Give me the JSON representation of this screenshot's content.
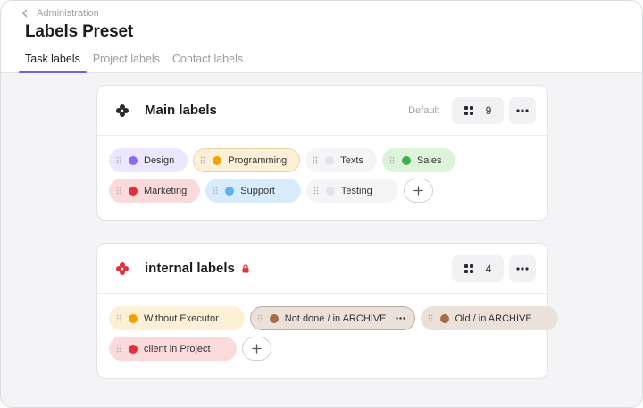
{
  "breadcrumb": {
    "label": "Administration"
  },
  "page": {
    "title": "Labels Preset"
  },
  "tabs": [
    {
      "label": "Task labels",
      "active": true
    },
    {
      "label": "Project labels",
      "active": false
    },
    {
      "label": "Contact labels",
      "active": false
    }
  ],
  "main_card": {
    "title": "Main labels",
    "default_text": "Default",
    "count": "9",
    "rows": [
      [
        {
          "label": "Design",
          "dot": "#8b6cf0",
          "bg": "#ece6ff"
        },
        {
          "label": "Programming",
          "dot": "#f5a100",
          "bg": "#fdf0d6"
        },
        {
          "label": "Texts",
          "dot": "#e3e4ea",
          "bg": "#f5f5f7"
        },
        {
          "label": "Sales",
          "dot": "#3ab44a",
          "bg": "#ddf3da"
        }
      ],
      [
        {
          "label": "Marketing",
          "dot": "#e0303d",
          "bg": "#fbdadc"
        },
        {
          "label": "Support",
          "dot": "#5cb2f5",
          "bg": "#d8ecfd"
        },
        {
          "label": "Testing",
          "dot": "#e3e4ea",
          "bg": "#f5f5f7"
        }
      ]
    ]
  },
  "internal_card": {
    "title": "internal labels",
    "count": "4",
    "rows": [
      [
        {
          "label": "Without Executor",
          "dot": "#f5a100",
          "bg": "#fdf0d6"
        },
        {
          "label": "Not done / in ARCHIVE",
          "dot": "#a46c47",
          "bg": "#ece1d8"
        },
        {
          "label": "Old / in ARCHIVE",
          "dot": "#a46c47",
          "bg": "#ece1d8"
        }
      ],
      [
        {
          "label": "client in Project",
          "dot": "#e0303d",
          "bg": "#fbdadc"
        }
      ]
    ]
  },
  "colors": {
    "accent": "#7a5cf0",
    "lock": "#e0303d",
    "internal_icon": "#e0303d"
  },
  "icons": [
    "chevron-left-icon",
    "clover-icon",
    "lock-icon",
    "grid-icon",
    "more-horizontal-icon",
    "drag-handle-icon",
    "plus-icon"
  ]
}
